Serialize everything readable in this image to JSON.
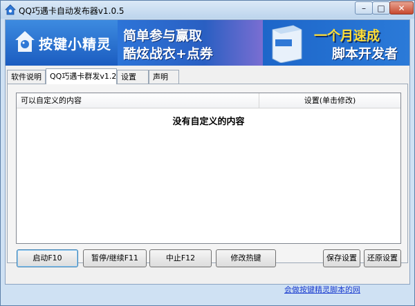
{
  "window": {
    "title": "QQ巧遇卡自动发布器v1.0.5",
    "controls": {
      "minimize": "–",
      "maximize": "□",
      "close": "✕"
    }
  },
  "banner": {
    "logo_text": "按键小精灵",
    "ad1": {
      "line1": "简单参与赢取",
      "line2": "酷炫战衣+点券"
    },
    "ad2": {
      "line1": "一个月速成",
      "line2": "脚本开发者"
    }
  },
  "tabs": [
    {
      "label": "软件说明",
      "active": false
    },
    {
      "label": "QQ巧遇卡群发v1.2",
      "active": true
    },
    {
      "label": "设置",
      "active": false
    },
    {
      "label": "声明",
      "active": false
    }
  ],
  "list": {
    "columns": [
      "可以自定义的内容",
      "设置(单击修改)"
    ],
    "empty_message": "没有自定义的内容"
  },
  "buttons": {
    "start": "启动F10",
    "pause": "暂停/继续F11",
    "stop": "中止F12",
    "hotkey": "修改热键",
    "save": "保存设置",
    "restore": "还原设置"
  },
  "footer": {
    "link": "会做按键精灵脚本的网"
  },
  "colors": {
    "accent": "#1f63c9",
    "link": "#1a3ccf",
    "frame": "#cfe1f3"
  }
}
